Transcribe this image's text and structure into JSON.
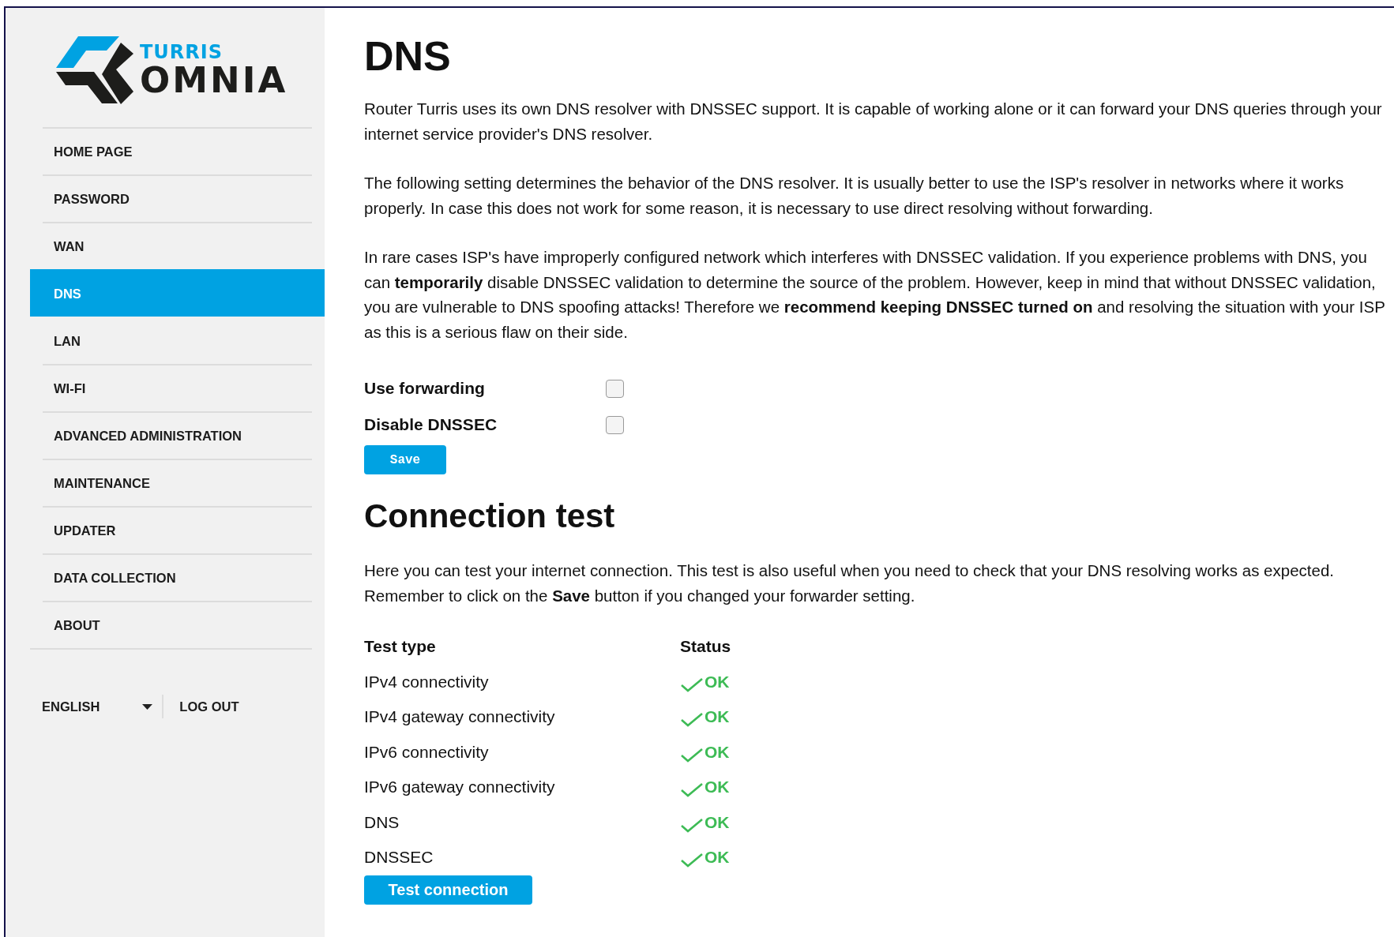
{
  "logo": {
    "top": "TURRIS",
    "bottom": "OMNIA"
  },
  "sidebar": {
    "items": [
      {
        "label": "HOME PAGE",
        "selected": false
      },
      {
        "label": "PASSWORD",
        "selected": false
      },
      {
        "label": "WAN",
        "selected": false
      },
      {
        "label": "DNS",
        "selected": true
      },
      {
        "label": "LAN",
        "selected": false
      },
      {
        "label": "WI-FI",
        "selected": false
      },
      {
        "label": "ADVANCED ADMINISTRATION",
        "selected": false
      },
      {
        "label": "MAINTENANCE",
        "selected": false
      },
      {
        "label": "UPDATER",
        "selected": false
      },
      {
        "label": "DATA COLLECTION",
        "selected": false
      },
      {
        "label": "ABOUT",
        "selected": false
      }
    ],
    "language": "ENGLISH",
    "logout": "LOG OUT"
  },
  "dns": {
    "title": "DNS",
    "paragraphs": [
      "Router Turris uses its own DNS resolver with DNSSEC support. It is capable of working alone or it can forward your DNS queries through your internet service provider's DNS resolver.",
      "The following setting determines the behavior of the DNS resolver. It is usually better to use the ISP's resolver in networks where it works properly. In case this does not work for some reason, it is necessary to use direct resolving without forwarding.",
      "In rare cases ISP's have improperly configured network which interferes with DNSSEC validation. If you experience problems with DNS, you can **temporarily** disable DNSSEC validation to determine the source of the problem. However, keep in mind that without DNSSEC validation, you are vulnerable to DNS spoofing attacks! Therefore we **recommend keeping DNSSEC turned on** and resolving the situation with your ISP as this is a serious flaw on their side."
    ],
    "options": [
      {
        "label": "Use forwarding",
        "checked": false
      },
      {
        "label": "Disable DNSSEC",
        "checked": false
      }
    ],
    "button": "Save"
  },
  "connection_test": {
    "title": "Connection test",
    "paragraph": "Here you can test your internet connection. This test is also useful when you need to check that your DNS resolving works as expected. Remember to click on the **Save** button if you changed your forwarder setting.",
    "columns": [
      "Test type",
      "Status"
    ],
    "rows": [
      {
        "test": "IPv4 connectivity",
        "status": "OK",
        "ok": true
      },
      {
        "test": "IPv4 gateway connectivity",
        "status": "OK",
        "ok": true
      },
      {
        "test": "IPv6 connectivity",
        "status": "OK",
        "ok": true
      },
      {
        "test": "IPv6 gateway connectivity",
        "status": "OK",
        "ok": true
      },
      {
        "test": "DNS",
        "status": "OK",
        "ok": true
      },
      {
        "test": "DNSSEC",
        "status": "OK",
        "ok": true
      }
    ],
    "button": "Test connection"
  }
}
